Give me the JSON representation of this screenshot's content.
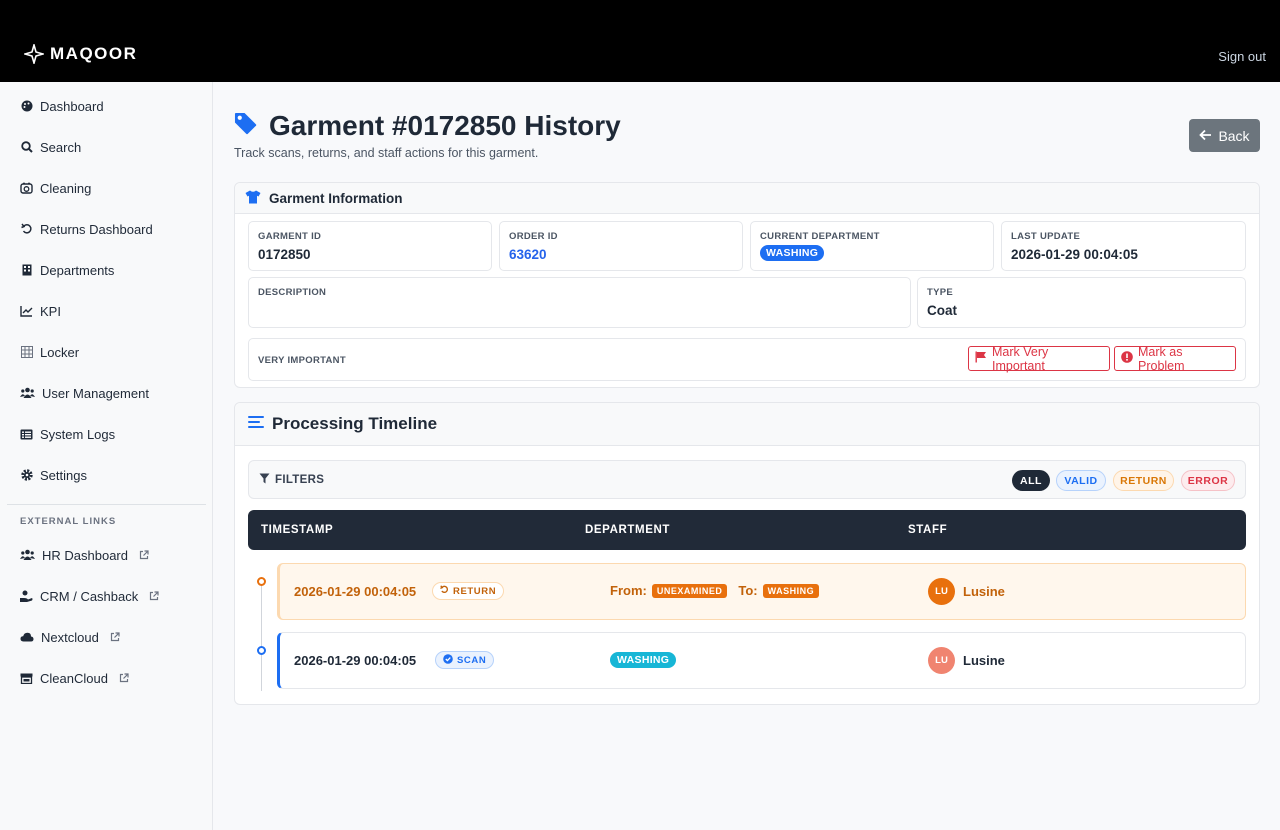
{
  "header": {
    "brand": "MAQOOR",
    "sign_out": "Sign out"
  },
  "sidebar": {
    "items": [
      {
        "label": "Dashboard",
        "icon": "palette-icon"
      },
      {
        "label": "Search",
        "icon": "search-icon"
      },
      {
        "label": "Cleaning",
        "icon": "washer-icon"
      },
      {
        "label": "Returns Dashboard",
        "icon": "undo-icon"
      },
      {
        "label": "Departments",
        "icon": "building-icon"
      },
      {
        "label": "KPI",
        "icon": "chart-line-icon"
      },
      {
        "label": "Locker",
        "icon": "locker-icon"
      },
      {
        "label": "User Management",
        "icon": "users-icon"
      },
      {
        "label": "System Logs",
        "icon": "list-icon"
      },
      {
        "label": "Settings",
        "icon": "gear-icon"
      }
    ],
    "external_section": "EXTERNAL LINKS",
    "external": [
      {
        "label": "HR Dashboard",
        "icon": "users-icon"
      },
      {
        "label": "CRM / Cashback",
        "icon": "hand-coin-icon"
      },
      {
        "label": "Nextcloud",
        "icon": "cloud-icon"
      },
      {
        "label": "CleanCloud",
        "icon": "store-icon"
      }
    ]
  },
  "page": {
    "title": "Garment #0172850 History",
    "subtitle": "Track scans, returns, and staff actions for this garment.",
    "back_label": "Back"
  },
  "garment_info": {
    "header": "Garment Information",
    "garment_id_label": "GARMENT ID",
    "garment_id": "0172850",
    "order_id_label": "ORDER ID",
    "order_id": "63620",
    "current_department_label": "CURRENT DEPARTMENT",
    "current_department": "WASHING",
    "last_update_label": "LAST UPDATE",
    "last_update": "2026-01-29 00:04:05",
    "description_label": "DESCRIPTION",
    "description": "",
    "type_label": "TYPE",
    "type": "Coat",
    "very_important_label": "VERY IMPORTANT",
    "mark_very_important": "Mark Very Important",
    "mark_as_problem": "Mark as Problem"
  },
  "timeline": {
    "header": "Processing Timeline",
    "filters_label": "FILTERS",
    "filters": {
      "all": "ALL",
      "valid": "VALID",
      "return": "RETURN",
      "error": "ERROR"
    },
    "columns": {
      "timestamp": "TIMESTAMP",
      "department": "DEPARTMENT",
      "staff": "STAFF"
    },
    "rows": [
      {
        "timestamp": "2026-01-29 00:04:05",
        "type": "RETURN",
        "from_label": "From:",
        "from": "UNEXAMINED",
        "to_label": "To:",
        "to": "WASHING",
        "staff_initials": "LU",
        "staff": "Lusine"
      },
      {
        "timestamp": "2026-01-29 00:04:05",
        "type": "SCAN",
        "department": "WASHING",
        "staff_initials": "LU",
        "staff": "Lusine"
      }
    ]
  },
  "colors": {
    "primary": "#1d6ef2",
    "danger": "#dc3545",
    "return": "#e8700d",
    "scan_dept": "#17b6d6",
    "dark": "#212a38"
  }
}
